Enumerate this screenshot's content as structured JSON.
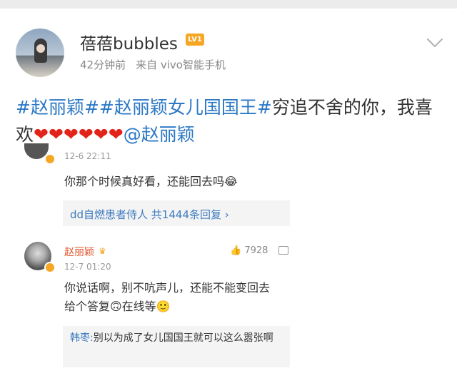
{
  "post": {
    "username": "蓓蓓bubbles",
    "level_badge": "LV1",
    "time": "42分钟前",
    "source": "来自 vivo智能手机",
    "tag1": "#赵丽颖#",
    "tag2": "#赵丽颖女儿国国王#",
    "text_mid": "穷追不舍的你，我喜欢",
    "hearts": "❤❤❤❤❤❤",
    "mention": "@赵丽颖"
  },
  "screenshot": {
    "comment1": {
      "time": "12-6 22:11",
      "text": "你那个时候真好看，还能回去吗😂",
      "reply_link": "dd自燃患者侍人 共1444条回复 ›"
    },
    "comment2": {
      "name": "赵丽颖",
      "crown": "♛",
      "time": "12-7 01:20",
      "likes": "7928",
      "text": "你说话啊，别不吭声儿，还能不能变回去给个答复🙃在线等🙂",
      "reply_name": "韩枣:",
      "reply_text": "别以为成了女儿国国王就可以这么嚣张啊"
    }
  },
  "icons": {
    "level": "level-badge-icon",
    "chevron": "chevron-down-icon",
    "like": "thumb-up-icon",
    "comment": "comment-icon"
  }
}
